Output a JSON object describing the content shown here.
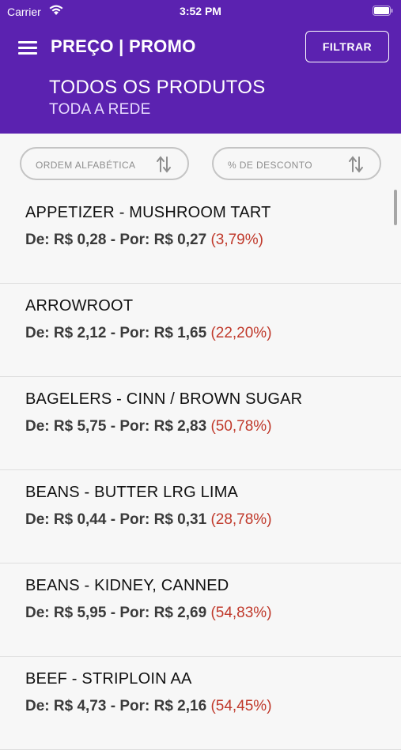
{
  "status": {
    "carrier": "Carrier",
    "time": "3:52 PM"
  },
  "header": {
    "title": "PREÇO | PROMO",
    "filter_label": "FILTRAR",
    "section_title": "TODOS OS PRODUTOS",
    "section_subtitle": "TODA A REDE"
  },
  "sort": {
    "alpha_label": "ORDEM ALFABÉTICA",
    "discount_label": "% DE DESCONTO"
  },
  "products": [
    {
      "name": "APPETIZER - MUSHROOM TART",
      "price_text": "De: R$ 0,28 - Por: R$ 0,27",
      "discount": "(3,79%)"
    },
    {
      "name": "ARROWROOT",
      "price_text": "De: R$ 2,12 - Por: R$ 1,65",
      "discount": "(22,20%)"
    },
    {
      "name": "BAGELERS - CINN / BROWN SUGAR",
      "price_text": "De: R$ 5,75 - Por: R$ 2,83",
      "discount": "(50,78%)"
    },
    {
      "name": "BEANS - BUTTER LRG LIMA",
      "price_text": "De: R$ 0,44 - Por: R$ 0,31",
      "discount": "(28,78%)"
    },
    {
      "name": "BEANS - KIDNEY, CANNED",
      "price_text": "De: R$ 5,95 - Por: R$ 2,69",
      "discount": "(54,83%)"
    },
    {
      "name": "BEEF - STRIPLOIN AA",
      "price_text": "De: R$ 4,73 - Por: R$ 2,16",
      "discount": "(54,45%)"
    }
  ],
  "colors": {
    "header": "#5b22b0",
    "discount": "#c0392b"
  }
}
